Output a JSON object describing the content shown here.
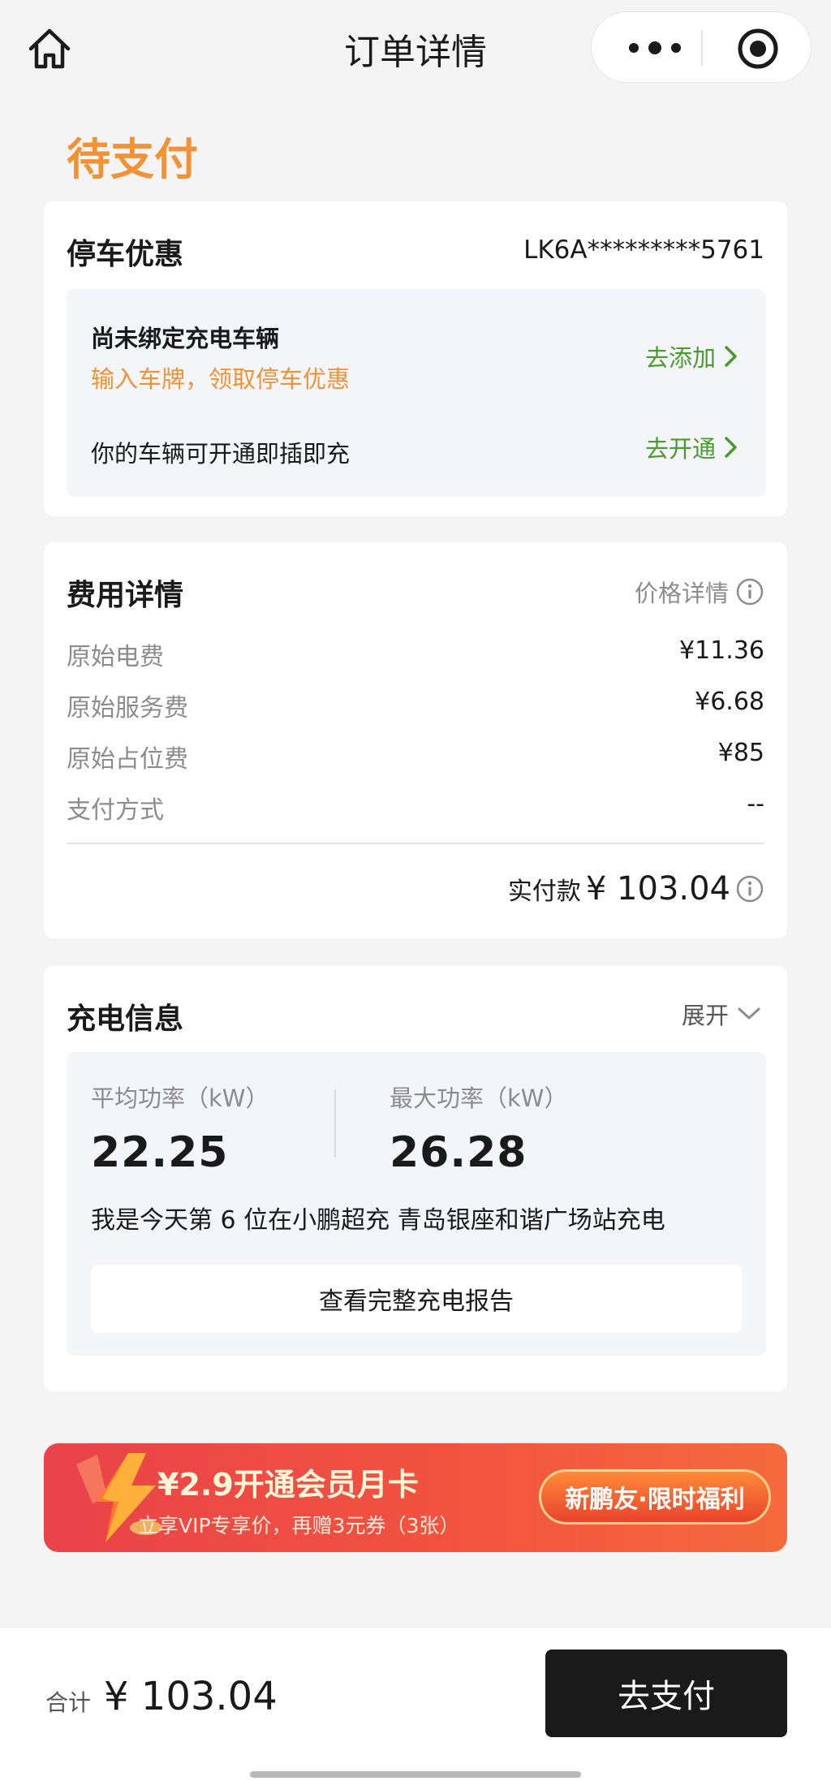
{
  "topbar": {
    "title": "订单详情",
    "home_icon": "home-icon",
    "more_icon": "more-dots-icon",
    "close_icon": "miniprogram-close-icon"
  },
  "status": {
    "label": "待支付",
    "color": "#f19236"
  },
  "parking": {
    "title": "停车优惠",
    "vin": "LK6A*********5761",
    "not_bound": "尚未绑定充电车辆",
    "hint": "输入车牌，领取停车优惠",
    "add_link": "去添加",
    "plug_text": "你的车辆可开通即插即充",
    "enable_link": "去开通"
  },
  "fees": {
    "title": "费用详情",
    "price_detail_link": "价格详情",
    "rows": [
      {
        "label": "原始电费",
        "value": "¥11.36"
      },
      {
        "label": "原始服务费",
        "value": "¥6.68"
      },
      {
        "label": "原始占位费",
        "value": "¥85"
      },
      {
        "label": "支付方式",
        "value": "--"
      }
    ],
    "paid_label": "实付款",
    "paid_amount": "¥ 103.04"
  },
  "charging": {
    "title": "充电信息",
    "expand_label": "展开",
    "avg_power_label": "平均功率（kW）",
    "avg_power_value": "22.25",
    "max_power_label": "最大功率（kW）",
    "max_power_value": "26.28",
    "rank_text": "我是今天第 6 位在小鹏超充 青岛银座和谐广场站充电",
    "report_button": "查看完整充电报告"
  },
  "banner": {
    "title": "¥2.9开通会员月卡",
    "subtitle": "立享VIP专享价，再赠3元券（3张）",
    "pill": "新鹏友·限时福利"
  },
  "bottom": {
    "total_label": "合计",
    "total_amount": "¥ 103.04",
    "pay_button": "去支付"
  },
  "colors": {
    "accent_orange": "#f19236",
    "link_green": "#4a9a2e",
    "pay_button_bg": "#1a1a1a",
    "banner_red": "#e8434a"
  }
}
